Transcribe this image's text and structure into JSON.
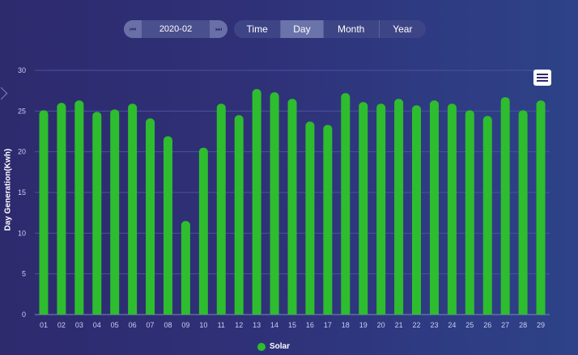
{
  "date_picker": {
    "value": "2020-02",
    "prev_icon": "step-back-icon",
    "next_icon": "step-forward-icon"
  },
  "tabs": [
    {
      "label": "Time",
      "active": false
    },
    {
      "label": "Day",
      "active": true
    },
    {
      "label": "Month",
      "active": false
    },
    {
      "label": "Year",
      "active": false
    }
  ],
  "colors": {
    "bar": "#2ebd2e",
    "accent": "#6a73aa"
  },
  "chart_data": {
    "type": "bar",
    "ylabel": "Day Generation(Kwh)",
    "xlabel": "",
    "ylim": [
      0,
      30
    ],
    "yticks": [
      "0",
      "5",
      "10",
      "15",
      "20",
      "25",
      "30"
    ],
    "grid": true,
    "legend_position": "bottom",
    "categories": [
      "01",
      "02",
      "03",
      "04",
      "05",
      "06",
      "07",
      "08",
      "09",
      "10",
      "11",
      "12",
      "13",
      "14",
      "15",
      "16",
      "17",
      "18",
      "19",
      "20",
      "21",
      "22",
      "23",
      "24",
      "25",
      "26",
      "27",
      "28",
      "29"
    ],
    "series": [
      {
        "name": "Solar",
        "values": [
          25.1,
          26.0,
          26.3,
          24.9,
          25.2,
          25.9,
          24.1,
          21.9,
          11.5,
          20.5,
          25.9,
          24.5,
          27.7,
          27.3,
          26.5,
          23.7,
          23.3,
          27.2,
          26.1,
          25.9,
          26.5,
          25.7,
          26.3,
          25.9,
          25.1,
          24.4,
          26.7,
          25.1,
          26.3
        ]
      }
    ]
  }
}
